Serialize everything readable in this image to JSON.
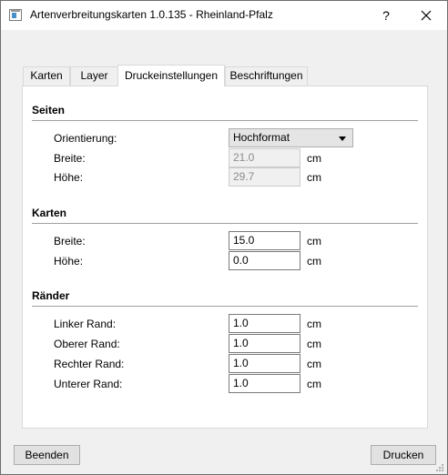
{
  "window": {
    "title": "Artenverbreitungskarten 1.0.135 - Rheinland-Pfalz",
    "help_label": "?",
    "close_icon": "close-icon",
    "app_icon": "map-window-icon"
  },
  "tabs": [
    {
      "label": "Karten",
      "active": false
    },
    {
      "label": "Layer",
      "active": false
    },
    {
      "label": "Druckeinstellungen",
      "active": true
    },
    {
      "label": "Beschriftungen",
      "active": false
    }
  ],
  "seiten": {
    "title": "Seiten",
    "orientation_label": "Orientierung:",
    "orientation_value": "Hochformat",
    "breite_label": "Breite:",
    "breite_value": "21.0",
    "hoehe_label": "Höhe:",
    "hoehe_value": "29.7",
    "unit": "cm"
  },
  "karten": {
    "title": "Karten",
    "breite_label": "Breite:",
    "breite_value": "15.0",
    "hoehe_label": "Höhe:",
    "hoehe_value": "0.0",
    "unit": "cm"
  },
  "raender": {
    "title": "Ränder",
    "linker_label": "Linker Rand:",
    "linker_value": "1.0",
    "oberer_label": "Oberer Rand:",
    "oberer_value": "1.0",
    "rechter_label": "Rechter Rand:",
    "rechter_value": "1.0",
    "unterer_label": "Unterer Rand:",
    "unterer_value": "1.0",
    "unit": "cm"
  },
  "footer": {
    "beenden_label": "Beenden",
    "drucken_label": "Drucken"
  }
}
